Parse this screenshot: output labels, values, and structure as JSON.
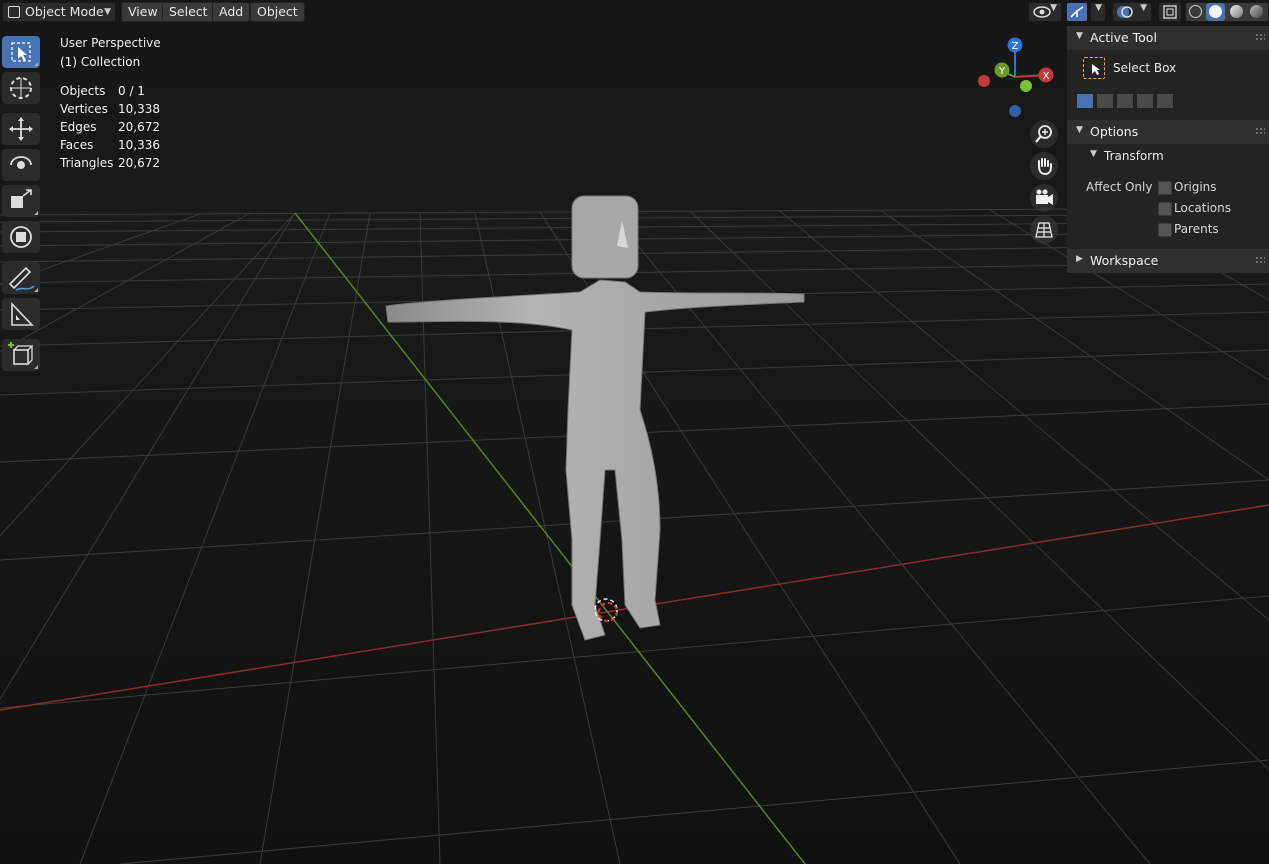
{
  "header": {
    "mode_label": "Object Mode",
    "menus": [
      "View",
      "Select",
      "Add",
      "Object"
    ]
  },
  "overlay": {
    "view_name": "User Perspective",
    "collection": "(1) Collection",
    "stats": [
      {
        "label": "Objects",
        "value": "0 / 1"
      },
      {
        "label": "Vertices",
        "value": "10,338"
      },
      {
        "label": "Edges",
        "value": "20,672"
      },
      {
        "label": "Faces",
        "value": "10,336"
      },
      {
        "label": "Triangles",
        "value": "20,672"
      }
    ]
  },
  "gizmo": {
    "z": "Z",
    "y": "Y",
    "x": "X"
  },
  "sidebar": {
    "active_tool_title": "Active Tool",
    "tool_name": "Select Box",
    "options_title": "Options",
    "transform_title": "Transform",
    "affect_only_label": "Affect Only",
    "checkboxes": [
      "Origins",
      "Locations",
      "Parents"
    ],
    "workspace_title": "Workspace"
  },
  "colors": {
    "accent": "#4772b3",
    "x_axis": "#c0393b",
    "y_axis": "#6c9a2a",
    "z_axis": "#2e74d4",
    "model": "#a9a9a9"
  },
  "icons": {
    "mode": "object-mode-cube-icon",
    "viewport_visibility": "eye-icon",
    "gizmo_toggle": "gizmo-icon",
    "overlays": "overlay-icon",
    "xray": "xray-icon",
    "shading": [
      "wireframe-icon",
      "solid-icon",
      "material-icon",
      "rendered-icon"
    ],
    "tools": [
      "select-box-icon",
      "cursor-icon",
      "move-icon",
      "rotate-icon",
      "scale-icon",
      "transform-icon",
      "annotate-icon",
      "measure-icon",
      "add-cube-icon"
    ],
    "navigation": [
      "zoom-icon",
      "hand-icon",
      "camera-icon",
      "grid-icon"
    ]
  }
}
